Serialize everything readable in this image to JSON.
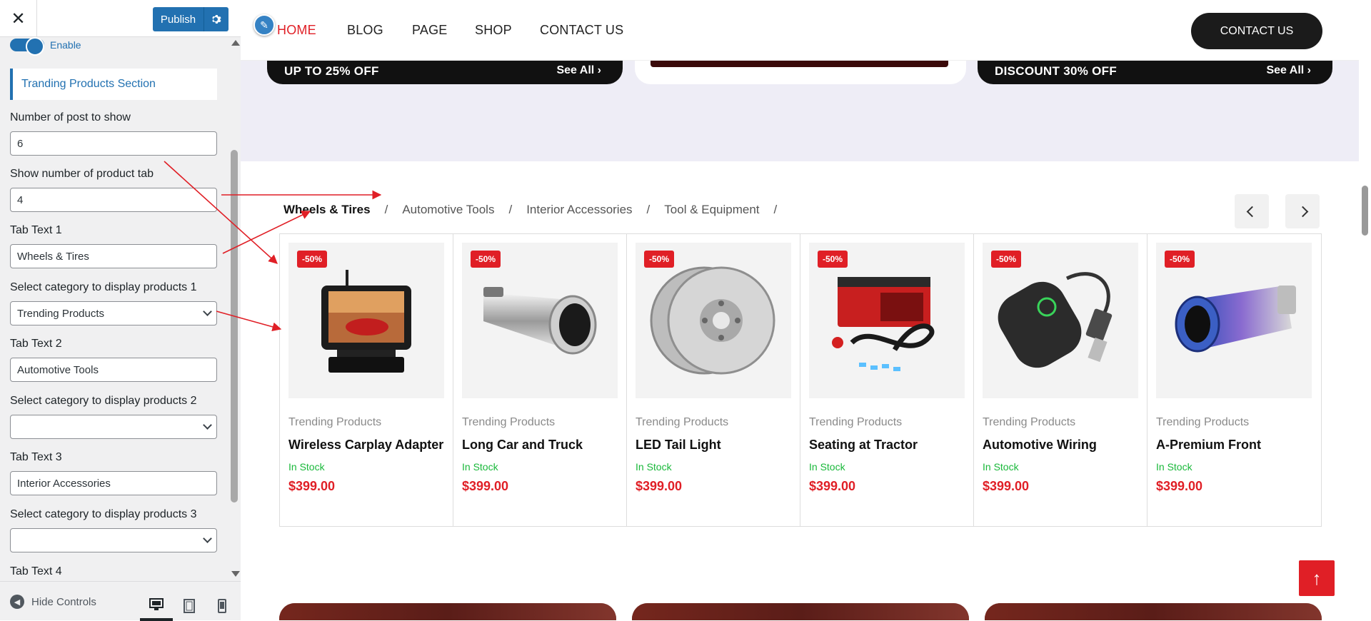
{
  "sidebar": {
    "close_glyph": "✕",
    "publish_label": "Publish",
    "enable_label": "Enable",
    "section_title": "Tranding Products Section",
    "fields": [
      {
        "label": "Number of post to show",
        "value": "6"
      },
      {
        "label": "Show number of product tab",
        "value": "4"
      },
      {
        "label": "Tab Text 1",
        "value": "Wheels & Tires"
      },
      {
        "label": "Select category to display products 1",
        "value": "Trending Products"
      },
      {
        "label": "Tab Text 2",
        "value": "Automotive Tools"
      },
      {
        "label": "Select category to display products 2",
        "value": ""
      },
      {
        "label": "Tab Text 3",
        "value": "Interior Accessories"
      },
      {
        "label": "Select category to display products 3",
        "value": ""
      },
      {
        "label": "Tab Text 4",
        "value": ""
      }
    ],
    "hide_controls_label": "Hide Controls"
  },
  "nav": {
    "items": [
      "HOME",
      "BLOG",
      "PAGE",
      "SHOP",
      "CONTACT US"
    ],
    "cta": "CONTACT US"
  },
  "promos": [
    {
      "title": "UP TO 25% OFF",
      "link": "See All"
    },
    {
      "title": "DISCOUNT 30% OFF",
      "link": "See All"
    }
  ],
  "tabs": [
    "Wheels & Tires",
    "Automotive Tools",
    "Interior Accessories",
    "Tool & Equipment"
  ],
  "tab_separator": "/",
  "products": [
    {
      "badge": "-50%",
      "category": "Trending Products",
      "name": "Wireless Carplay Adapter",
      "stock": "In Stock",
      "price": "$399.00"
    },
    {
      "badge": "-50%",
      "category": "Trending Products",
      "name": "Long Car and Truck",
      "stock": "In Stock",
      "price": "$399.00"
    },
    {
      "badge": "-50%",
      "category": "Trending Products",
      "name": "LED Tail Light",
      "stock": "In Stock",
      "price": "$399.00"
    },
    {
      "badge": "-50%",
      "category": "Trending Products",
      "name": "Seating at Tractor",
      "stock": "In Stock",
      "price": "$399.00"
    },
    {
      "badge": "-50%",
      "category": "Trending Products",
      "name": "Automotive Wiring",
      "stock": "In Stock",
      "price": "$399.00"
    },
    {
      "badge": "-50%",
      "category": "Trending Products",
      "name": "A-Premium Front",
      "stock": "In Stock",
      "price": "$399.00"
    }
  ],
  "colors": {
    "accent": "#e01f26",
    "wp_blue": "#2271b1",
    "stock_green": "#19b83a",
    "annotation": "#e01f26"
  }
}
